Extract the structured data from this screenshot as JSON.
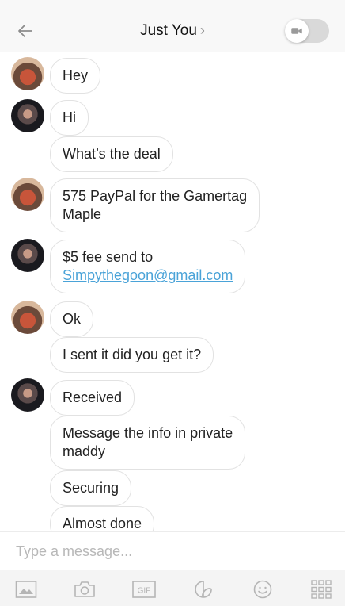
{
  "header": {
    "title": "Just You",
    "chevron": "›",
    "back_icon": "back-arrow-icon",
    "video_icon": "video-camera-icon"
  },
  "messages": [
    {
      "sender": "user_a",
      "text": "Hey"
    },
    {
      "sender": "user_b",
      "text": "Hi"
    },
    {
      "sender": "user_b",
      "text": "What’s the deal"
    },
    {
      "sender": "user_a",
      "text_line1": "575 PayPal for the Gamertag",
      "text_line2": "Maple"
    },
    {
      "sender": "user_b",
      "text_line1": "$5 fee send to",
      "link": "Simpythegoon@gmail.com"
    },
    {
      "sender": "user_a",
      "text": "Ok"
    },
    {
      "sender": "user_a",
      "text": "I sent it did you get it?"
    },
    {
      "sender": "user_b",
      "text": "Received"
    },
    {
      "sender": "user_b",
      "text_line1": "Message the info in private",
      "text_line2": "maddy"
    },
    {
      "sender": "user_b",
      "text": "Securing"
    },
    {
      "sender": "user_b",
      "text": "Almost done"
    }
  ],
  "composer": {
    "placeholder": "Type a message...",
    "value": ""
  },
  "toolbar": {
    "items": [
      "image-icon",
      "camera-icon",
      "gif-icon",
      "sticker-icon",
      "emoji-icon",
      "apps-grid-icon"
    ],
    "gif_label": "GIF"
  },
  "colors": {
    "link": "#4aa3d8",
    "bubble_border": "#e2e2e2",
    "toolbar_bg": "#f4f4f4",
    "icon_gray": "#b5b5b5"
  }
}
